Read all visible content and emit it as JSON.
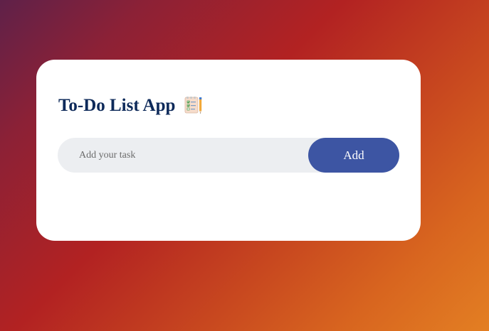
{
  "app": {
    "title": "To-Do List App",
    "title_icon": "notepad-checklist-icon"
  },
  "task_input": {
    "value": "",
    "placeholder": "Add your task"
  },
  "add_button": {
    "label": "Add"
  },
  "colors": {
    "title": "#0e2a5a",
    "button": "#3d55a3",
    "input_bg": "#eceef1",
    "card_bg": "#ffffff",
    "gradient": [
      "#5f2149",
      "#b22222",
      "#e37f23"
    ]
  }
}
